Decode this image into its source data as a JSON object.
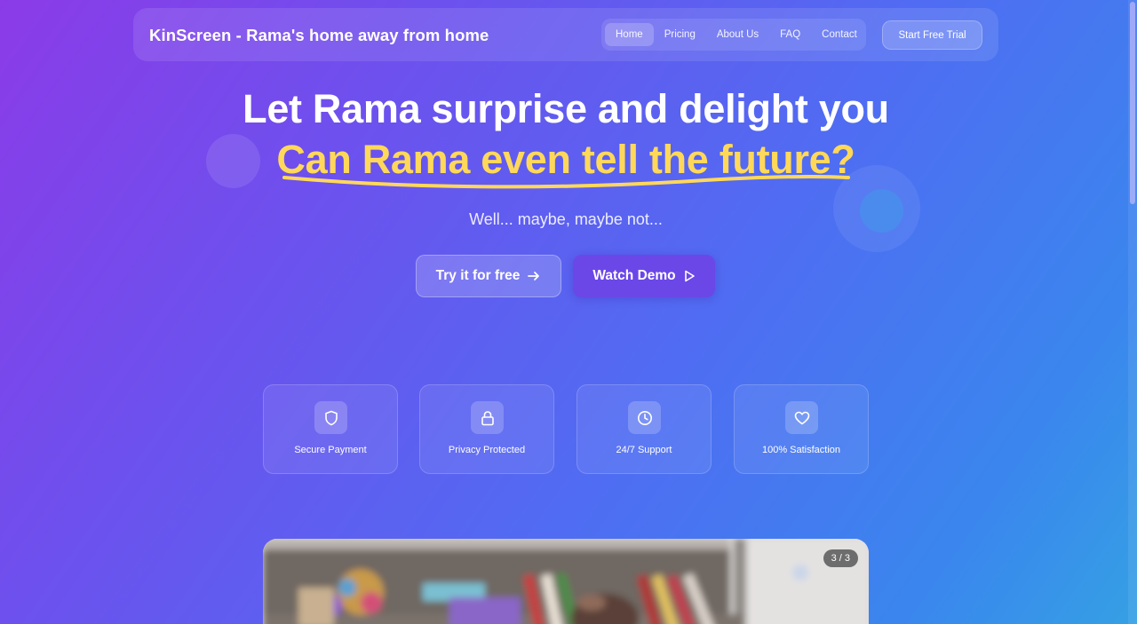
{
  "nav": {
    "brand": "KinScreen - Rama's home away from home",
    "links": [
      "Home",
      "Pricing",
      "About Us",
      "FAQ",
      "Contact"
    ],
    "active": "Home",
    "cta": "Start Free Trial"
  },
  "hero": {
    "title": "Let Rama surprise and delight you",
    "subtitle": "Can Rama even tell the future?",
    "tagline": "Well... maybe, maybe not...",
    "primary_cta": "Try it for free",
    "secondary_cta": "Watch Demo"
  },
  "features": [
    {
      "label": "Secure Payment",
      "icon": "shield-icon"
    },
    {
      "label": "Privacy Protected",
      "icon": "lock-icon"
    },
    {
      "label": "24/7 Support",
      "icon": "clock-icon"
    },
    {
      "label": "100% Satisfaction",
      "icon": "heart-icon"
    }
  ],
  "carousel": {
    "counter": "3 / 3"
  },
  "colors": {
    "accent_yellow": "#ffd85a",
    "button_purple": "#6b47e8"
  }
}
